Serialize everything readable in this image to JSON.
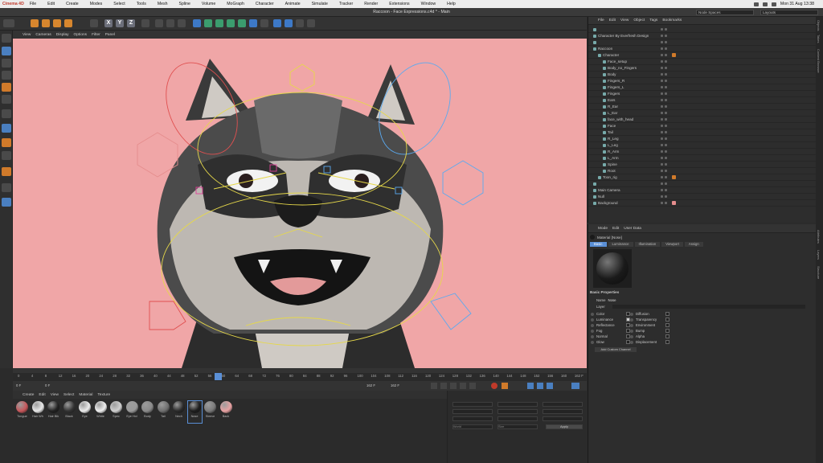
{
  "mac_menu": {
    "app": "Cinema 4D",
    "items": [
      "File",
      "Edit",
      "Create",
      "Modes",
      "Select",
      "Tools",
      "Mesh",
      "Spline",
      "Volume",
      "MoGraph",
      "Character",
      "Animate",
      "Simulate",
      "Tracker",
      "Render",
      "Extensions",
      "Window",
      "Help"
    ],
    "clock": "Mon 31 Aug  13:38"
  },
  "window": {
    "title": "Raccoon - Face Expressions.c4d * - Main",
    "node_spaces": "Node Spaces",
    "layouts": "Layouts"
  },
  "toolbar": {
    "x": "X",
    "y": "Y",
    "z": "Z"
  },
  "viewport": {
    "menu": [
      "View",
      "Cameras",
      "Display",
      "Options",
      "Filter",
      "Panel"
    ],
    "background_color": "#f0a6a7",
    "frame_readout": "153 / 162 F"
  },
  "timeline": {
    "ticks": [
      "0",
      "4",
      "8",
      "12",
      "16",
      "20",
      "24",
      "28",
      "32",
      "36",
      "40",
      "44",
      "48",
      "52",
      "56",
      "60",
      "64",
      "68",
      "72",
      "76",
      "80",
      "84",
      "88",
      "92",
      "96",
      "100",
      "104",
      "108",
      "112",
      "116",
      "120",
      "124",
      "128",
      "132",
      "136",
      "140",
      "144",
      "148",
      "152",
      "156",
      "160",
      "162 F"
    ],
    "current_frame": "0 F",
    "start_frame": "0 F",
    "end_frame": "162 F",
    "end_frame_2": "162 F"
  },
  "materials": {
    "menu": [
      "Create",
      "Edit",
      "View",
      "Select",
      "Material",
      "Texture"
    ],
    "items": [
      {
        "label": "Tongue",
        "color": "#c7575b"
      },
      {
        "label": "Hair Wh",
        "color": "#e8e8e8"
      },
      {
        "label": "Hair Blk",
        "color": "#222222"
      },
      {
        "label": "Black",
        "color": "#333333"
      },
      {
        "label": "Eye",
        "color": "#ededed"
      },
      {
        "label": "White",
        "color": "#f0f0f0"
      },
      {
        "label": "Spec",
        "color": "#d0d0d0"
      },
      {
        "label": "Eye Hol",
        "color": "#9a9a9a"
      },
      {
        "label": "Body",
        "color": "#8a8a8a"
      },
      {
        "label": "Tail",
        "color": "#6f6f6f"
      },
      {
        "label": "Nech",
        "color": "#2a2a2a"
      },
      {
        "label": "Nose",
        "color": "#1e1e1e"
      },
      {
        "label": "Sleeve",
        "color": "#7a7a7a"
      },
      {
        "label": "Back",
        "color": "#e8a2a3"
      }
    ]
  },
  "coords": {
    "apply": "Apply",
    "world": "World",
    "size": "Size"
  },
  "objects": {
    "menu": [
      "File",
      "Edit",
      "View",
      "Object",
      "Tags",
      "Bookmarks"
    ],
    "rows": [
      {
        "name": "",
        "indent": 1
      },
      {
        "name": "Character By Everfresh Design",
        "indent": 1
      },
      {
        "name": "",
        "indent": 1
      },
      {
        "name": "Raccoon",
        "indent": 1
      },
      {
        "name": "Character",
        "indent": 2
      },
      {
        "name": "Face_setup",
        "indent": 3
      },
      {
        "name": "Body_no_Fingers",
        "indent": 3
      },
      {
        "name": "Body",
        "indent": 3
      },
      {
        "name": "Fingers_R",
        "indent": 3
      },
      {
        "name": "Fingers_L",
        "indent": 3
      },
      {
        "name": "Fingers",
        "indent": 3
      },
      {
        "name": "Ears",
        "indent": 3
      },
      {
        "name": "R_Ear",
        "indent": 3
      },
      {
        "name": "L_Ear",
        "indent": 3
      },
      {
        "name": "face_with_head",
        "indent": 3
      },
      {
        "name": "Face",
        "indent": 3
      },
      {
        "name": "Tail",
        "indent": 3
      },
      {
        "name": "R_Leg",
        "indent": 3
      },
      {
        "name": "L_Leg",
        "indent": 3
      },
      {
        "name": "R_Arm",
        "indent": 3
      },
      {
        "name": "L_Arm",
        "indent": 3
      },
      {
        "name": "Spine",
        "indent": 3
      },
      {
        "name": "Root",
        "indent": 3
      },
      {
        "name": "Toon_rig",
        "indent": 2
      },
      {
        "name": "",
        "indent": 1
      },
      {
        "name": "Main Camera",
        "indent": 1
      },
      {
        "name": "Null",
        "indent": 1
      },
      {
        "name": "Background",
        "indent": 1
      }
    ]
  },
  "attributes": {
    "menu": [
      "Mode",
      "Edit",
      "User Data"
    ],
    "object_label": "Material [Nose]",
    "tabs": [
      "Basic",
      "Luminance",
      "Illumination",
      "Viewport",
      "Assign"
    ],
    "section": "Basic Properties",
    "name_label": "Name",
    "name_value": "Nose",
    "layer_label": "Layer",
    "left_props": [
      {
        "label": "Color",
        "checked": false
      },
      {
        "label": "Luminance",
        "checked": true
      },
      {
        "label": "Reflectance",
        "checked": false
      },
      {
        "label": "Fog",
        "checked": false
      },
      {
        "label": "Normal",
        "checked": false
      },
      {
        "label": "Glow",
        "checked": false
      }
    ],
    "right_props": [
      {
        "label": "Diffusion",
        "checked": false
      },
      {
        "label": "Transparency",
        "checked": false
      },
      {
        "label": "Environment",
        "checked": false
      },
      {
        "label": "Bump",
        "checked": false
      },
      {
        "label": "Alpha",
        "checked": false
      },
      {
        "label": "Displacement",
        "checked": false
      }
    ],
    "add_button": "Add Custom Channel"
  },
  "side_tabs": [
    "Objects",
    "Takes",
    "Content Browser",
    "Attributes",
    "Layers",
    "Structure"
  ]
}
